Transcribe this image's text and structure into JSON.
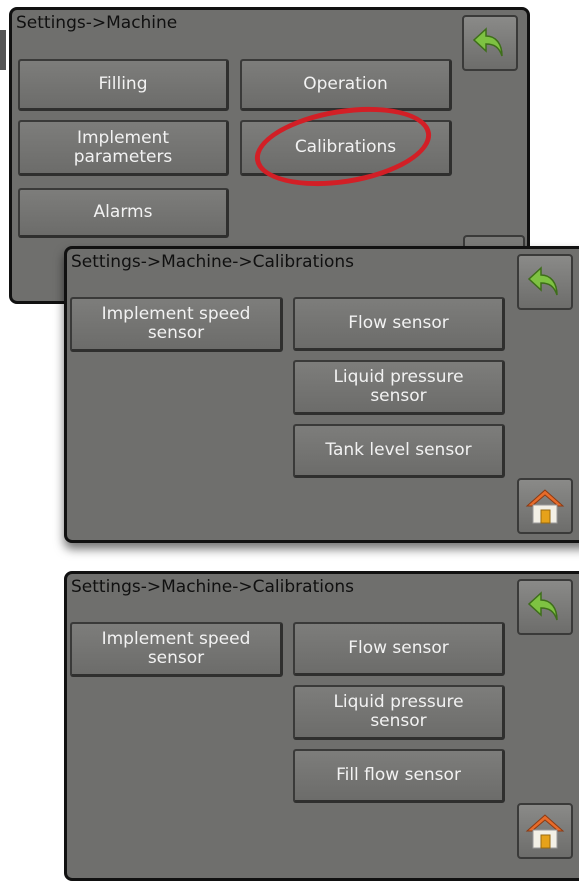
{
  "panel1": {
    "title": "Settings->Machine",
    "buttons": {
      "filling": "Filling",
      "operation": "Operation",
      "implement_line1": "Implement",
      "implement_line2": "parameters",
      "calibrations": "Calibrations",
      "alarms": "Alarms"
    },
    "icons": [
      "back-arrow-icon"
    ]
  },
  "panel2": {
    "title": "Settings->Machine->Calibrations",
    "buttons": {
      "implement_speed_line1": "Implement speed",
      "implement_speed_line2": "sensor",
      "flow_sensor": "Flow sensor",
      "liquid_pressure_line1": "Liquid pressure",
      "liquid_pressure_line2": "sensor",
      "tank_level_sensor": "Tank level sensor"
    },
    "icons": [
      "back-arrow-icon",
      "home-icon"
    ]
  },
  "panel3": {
    "title": "Settings->Machine->Calibrations",
    "buttons": {
      "implement_speed_line1": "Implement speed",
      "implement_speed_line2": "sensor",
      "flow_sensor": "Flow sensor",
      "liquid_pressure_line1": "Liquid pressure",
      "liquid_pressure_line2": "sensor",
      "fill_flow_sensor": "Fill flow sensor"
    },
    "icons": [
      "back-arrow-icon",
      "home-icon"
    ]
  },
  "colors": {
    "panel_bg": "#6f6f6d",
    "border": "#111111",
    "highlight_circle": "#d21f26",
    "back_arrow": "#7ec242",
    "home_roof": "#e76b2a"
  }
}
